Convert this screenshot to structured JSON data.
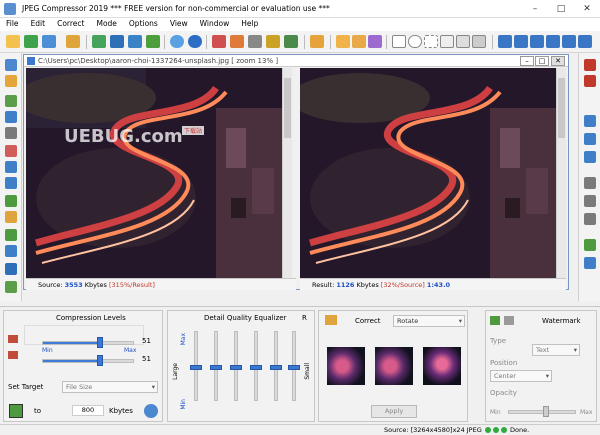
{
  "window": {
    "title": "JPEG Compressor 2019   ***  FREE version for non-commercial or evaluation use ***",
    "min_icon": "minimize-icon",
    "max_icon": "maximize-icon",
    "close_icon": "close-icon"
  },
  "menu": [
    "File",
    "Edit",
    "Correct",
    "Mode",
    "Options",
    "View",
    "Window",
    "Help"
  ],
  "document": {
    "title": "C:\\Users\\pc\\Desktop\\aaron-choi-1337264-unsplash.jpg  [ zoom 13% ]",
    "watermark_text": "UEBUG.com",
    "watermark_tag": "下载站",
    "left_status": {
      "label": "Source:",
      "value": "3553",
      "unit": "Kbytes",
      "pct": "[315%/Result]"
    },
    "right_status": {
      "label": "Result:",
      "value": "1126",
      "unit": "Kbytes",
      "pct": "[32%/Source]",
      "ratio": "1:43.0"
    }
  },
  "compression": {
    "title": "Compression Levels",
    "min_label": "Min",
    "max_label": "Max",
    "slider1": {
      "value": "51",
      "level": 0.62
    },
    "slider2": {
      "value": "51",
      "level": 0.62
    },
    "set_target_label": "Set Target",
    "set_target_value": "File Size",
    "to_label": "to",
    "target_value": "800",
    "unit_label": "Kbytes"
  },
  "equalizer": {
    "title": "Detail Quality Equalizer",
    "r_label": "R",
    "large_label": "Large",
    "small_label": "Small",
    "max_label": "Max",
    "min_label": "Min",
    "levels": [
      0.5,
      0.5,
      0.5,
      0.5,
      0.5,
      0.5
    ]
  },
  "correct": {
    "title": "Correct",
    "mode": "Rotate",
    "apply_label": "Apply"
  },
  "watermark": {
    "title": "Watermark",
    "type_label": "Type",
    "type_value": "Text",
    "position_label": "Position",
    "position_value": "Center",
    "opacity_label": "Opacity",
    "min_label": "Min",
    "max_label": "Max"
  },
  "status": {
    "source_info": "Source: [3264x4580]x24 JPEG",
    "done": "Done."
  },
  "colors": {
    "accent": "#3b78d0",
    "result_blue": "#1b4fc4",
    "pct_red": "#c0392b"
  }
}
